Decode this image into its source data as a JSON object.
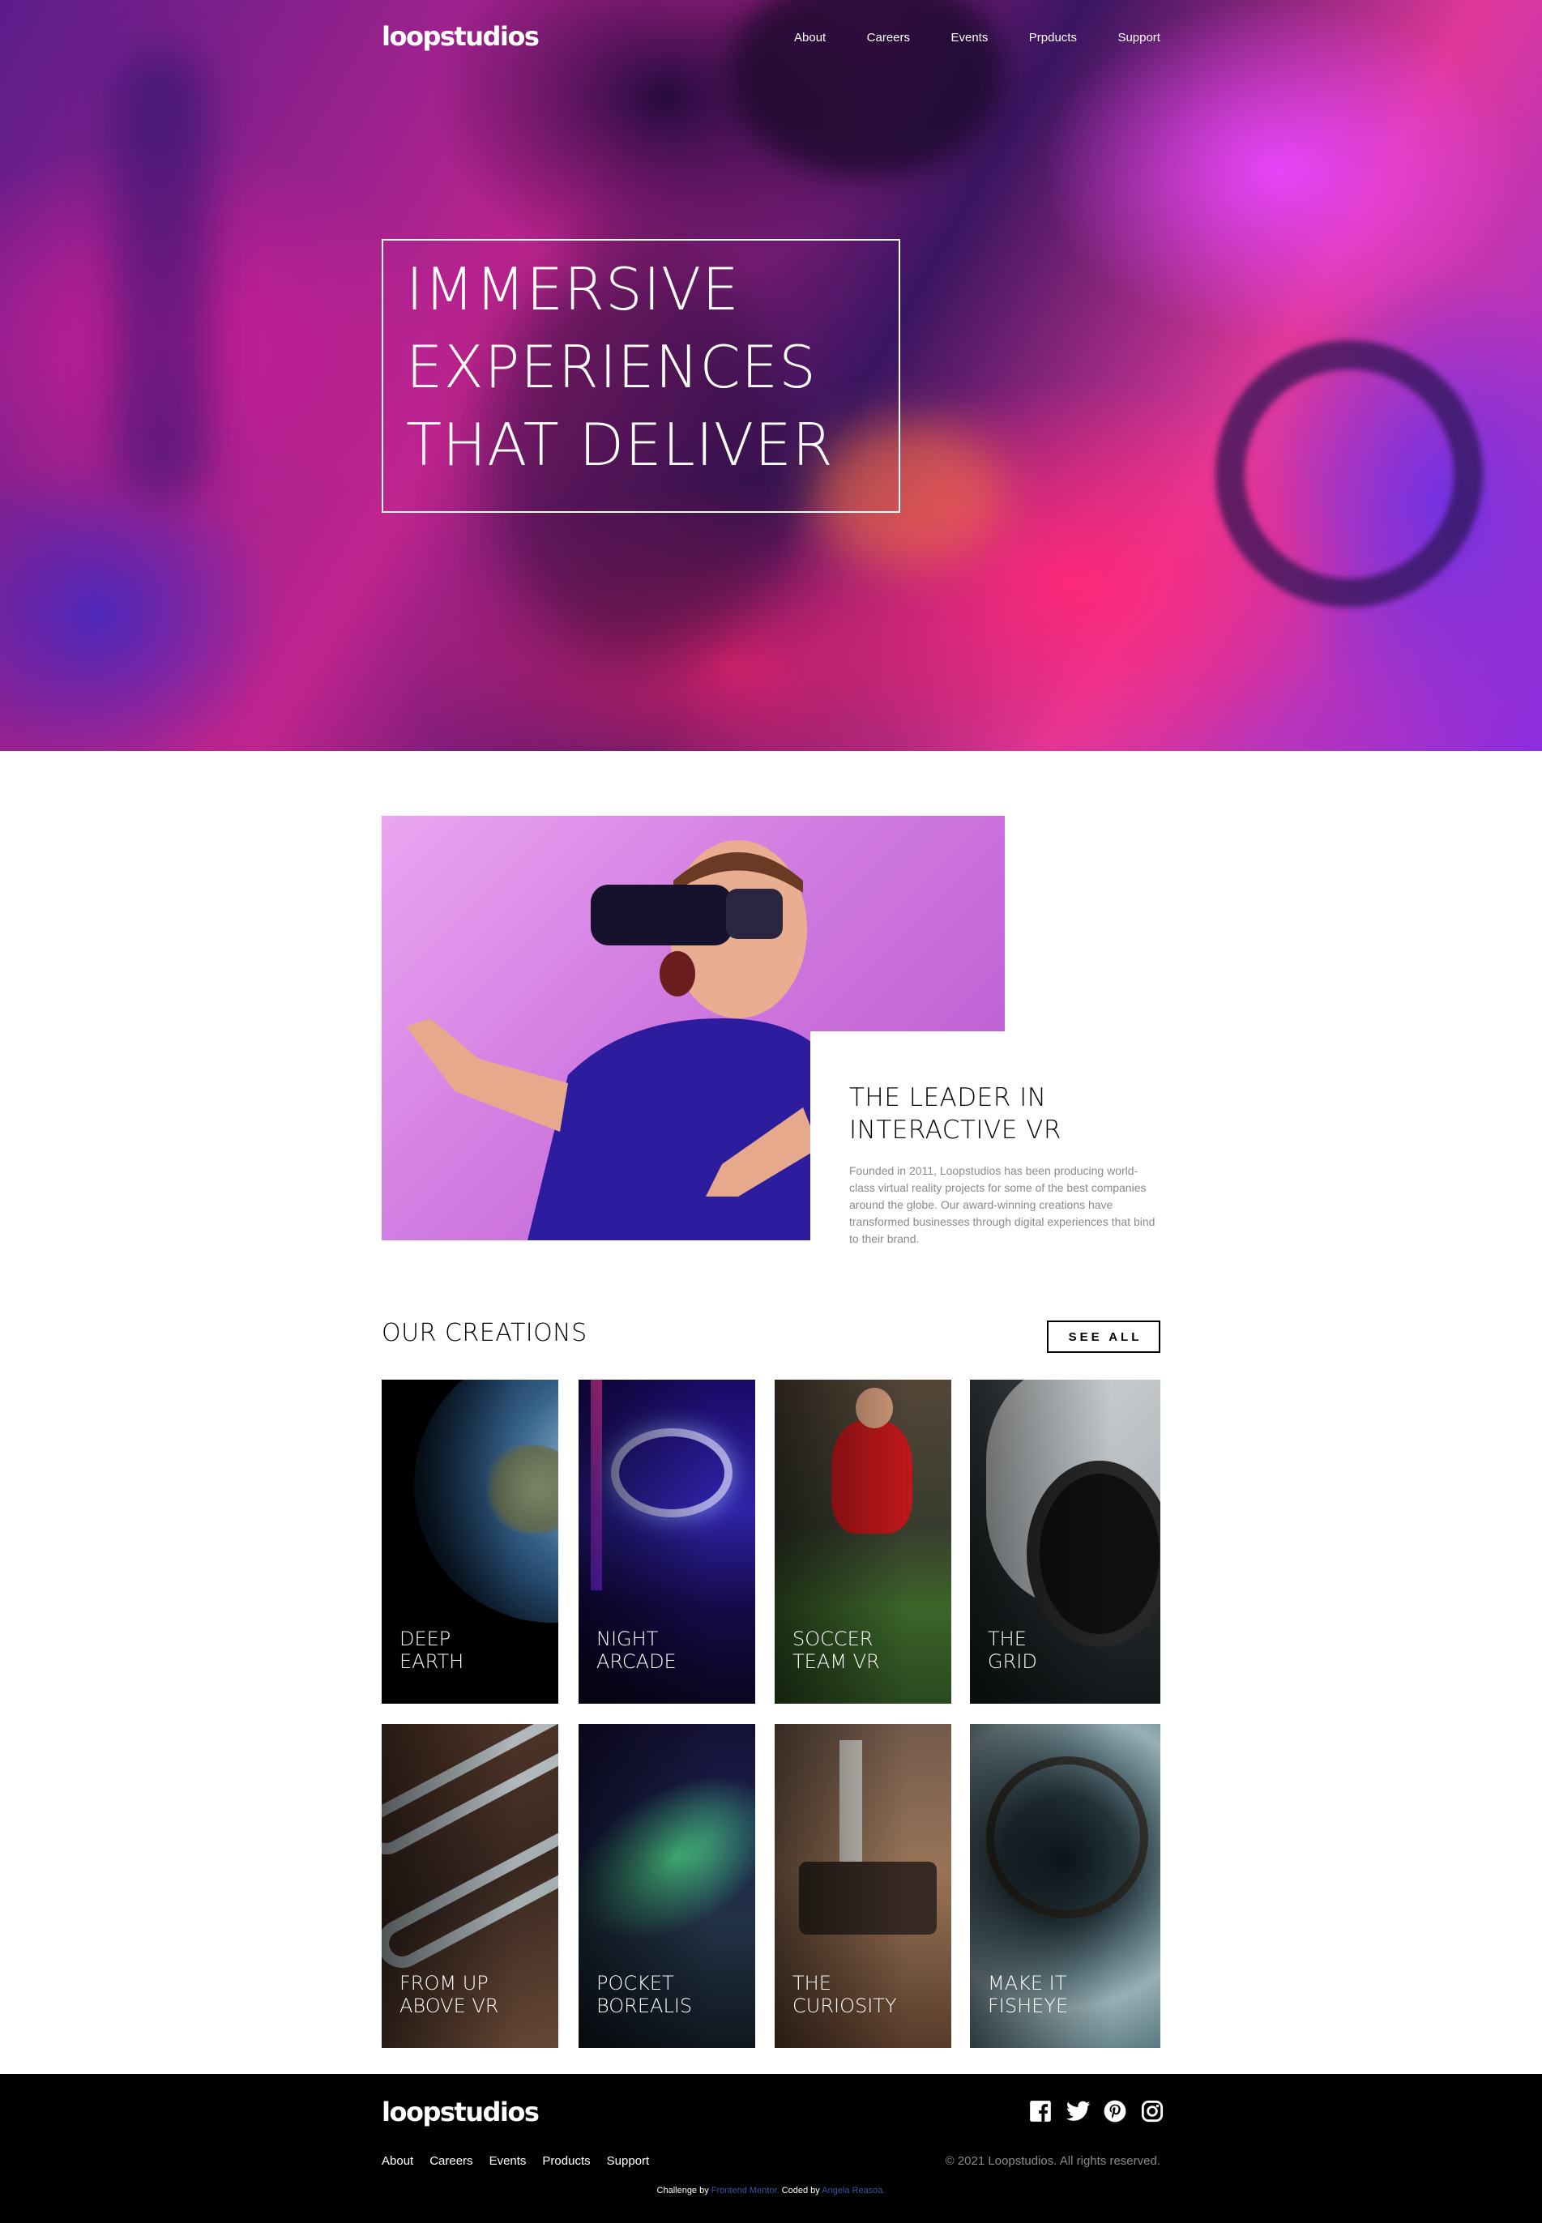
{
  "brand": {
    "logo_text": "loopstudios"
  },
  "nav": {
    "links": [
      "About",
      "Careers",
      "Events",
      "Prpducts",
      "Support"
    ]
  },
  "hero": {
    "headline": "IMMERSIVE\nEXPERIENCES\nTHAT DELIVER"
  },
  "intro": {
    "title": "THE LEADER IN\nINTERACTIVE VR",
    "body": "Founded in 2011, Loopstudios has been producing world-class virtual reality projects for some of the best companies around the globe. Our award-winning creations have transformed businesses through digital experiences that bind to their brand."
  },
  "creations": {
    "title": "OUR CREATIONS",
    "see_all_label": "SEE ALL",
    "items": [
      {
        "label": "DEEP\nEARTH"
      },
      {
        "label": "NIGHT\nARCADE"
      },
      {
        "label": "SOCCER\nTEAM VR"
      },
      {
        "label": "THE\nGRID"
      },
      {
        "label": "FROM UP\nABOVE VR"
      },
      {
        "label": "POCKET\nBOREALIS"
      },
      {
        "label": "THE\nCURIOSITY"
      },
      {
        "label": "MAKE IT\nFISHEYE"
      }
    ]
  },
  "footer": {
    "logo_text": "loopstudios",
    "links": [
      "About",
      "Careers",
      "Events",
      "Products",
      "Support"
    ],
    "social_icons": [
      "facebook-icon",
      "twitter-icon",
      "pinterest-icon",
      "instagram-icon"
    ],
    "copyright": "© 2021 Loopstudios. All rights reserved.",
    "attribution": {
      "challenge_prefix": "Challenge by",
      "challenge_link": "Frontend Mentor.",
      "coded_prefix": "Coded by",
      "coded_link": "Angela Reasoa."
    }
  }
}
